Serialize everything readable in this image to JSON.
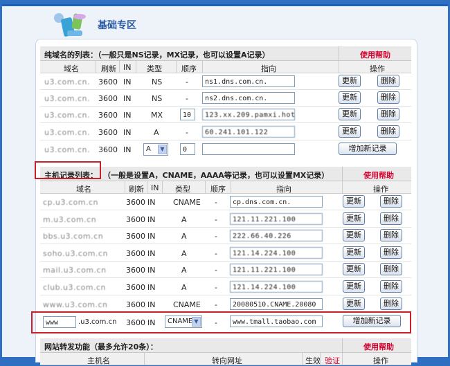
{
  "header": {
    "title": "基础专区"
  },
  "sec1": {
    "title": "纯域名的列表：（一般只是NS记录，MX记录，也可以设置A记录）",
    "help": "使用帮助",
    "cols": {
      "domain": "域名",
      "refresh": "刷新",
      "in": "IN",
      "type": "类型",
      "order": "顺序",
      "target": "指向",
      "ops": "操作"
    },
    "rows": [
      {
        "domain": "u3.com.cn.",
        "refresh": "3600",
        "in": "IN",
        "type": "NS",
        "order": "-",
        "target": "ns1.dns.com.cn."
      },
      {
        "domain": "u3.com.cn.",
        "refresh": "3600",
        "in": "IN",
        "type": "NS",
        "order": "-",
        "target": "ns2.dns.com.cn."
      },
      {
        "domain": "u3.com.cn.",
        "refresh": "3600",
        "in": "IN",
        "type": "MX",
        "order": "10",
        "target": "123.xx.209.pamxi.hotm"
      },
      {
        "domain": "u3.com.cn.",
        "refresh": "3600",
        "in": "IN",
        "type": "A",
        "order": "-",
        "target": "60.241.101.122"
      }
    ],
    "new_row": {
      "domain": "u3.com.cn.",
      "refresh": "3600",
      "in": "IN",
      "type": "A",
      "order": "0",
      "target": ""
    },
    "update": "更新",
    "delete": "删除",
    "add": "增加新记录"
  },
  "sec2": {
    "title": "主机记录列表：",
    "subtitle": "（一般是设置A，CNAME，AAAA等记录，也可以设置MX记录）",
    "help": "使用帮助",
    "cols": {
      "domain": "域名",
      "refresh": "刷新",
      "in": "IN",
      "type": "类型",
      "order": "顺序",
      "target": "指向",
      "ops": "操作"
    },
    "rows": [
      {
        "domain": "cp.u3.com.cn",
        "refresh": "3600",
        "in": "IN",
        "type": "CNAME",
        "order": "-",
        "target": "cp.dns.com.cn."
      },
      {
        "domain": "m.u3.com.cn",
        "refresh": "3600",
        "in": "IN",
        "type": "A",
        "order": "-",
        "target": "121.11.221.100"
      },
      {
        "domain": "bbs.u3.com.cn",
        "refresh": "3600",
        "in": "IN",
        "type": "A",
        "order": "-",
        "target": "222.66.40.226"
      },
      {
        "domain": "soho.u3.com.cn",
        "refresh": "3600",
        "in": "IN",
        "type": "A",
        "order": "-",
        "target": "121.14.224.100"
      },
      {
        "domain": "mail.u3.com.cn",
        "refresh": "3600",
        "in": "IN",
        "type": "A",
        "order": "-",
        "target": "121.11.221.100"
      },
      {
        "domain": "club.u3.com.cn",
        "refresh": "3600",
        "in": "IN",
        "type": "A",
        "order": "-",
        "target": "121.14.224.100"
      },
      {
        "domain": "www.u3.com.cn",
        "refresh": "3600",
        "in": "IN",
        "type": "CNAME",
        "order": "-",
        "target": "20080510.CNAME.20080"
      }
    ],
    "new_row": {
      "host": "www",
      "suffix": ".u3.com.cn",
      "refresh": "3600",
      "in": "IN",
      "type": "CNAME",
      "order": "-",
      "target": "www.tmall.taobao.com"
    },
    "update": "更新",
    "delete": "删除",
    "add": "增加新记录"
  },
  "sec3": {
    "title": "网站转发功能（最多允许20条）：",
    "help": "使用帮助",
    "cols": {
      "host": "主机名",
      "url": "转向网址",
      "status": "生效",
      "verify": "验证",
      "ops": "操作"
    }
  }
}
